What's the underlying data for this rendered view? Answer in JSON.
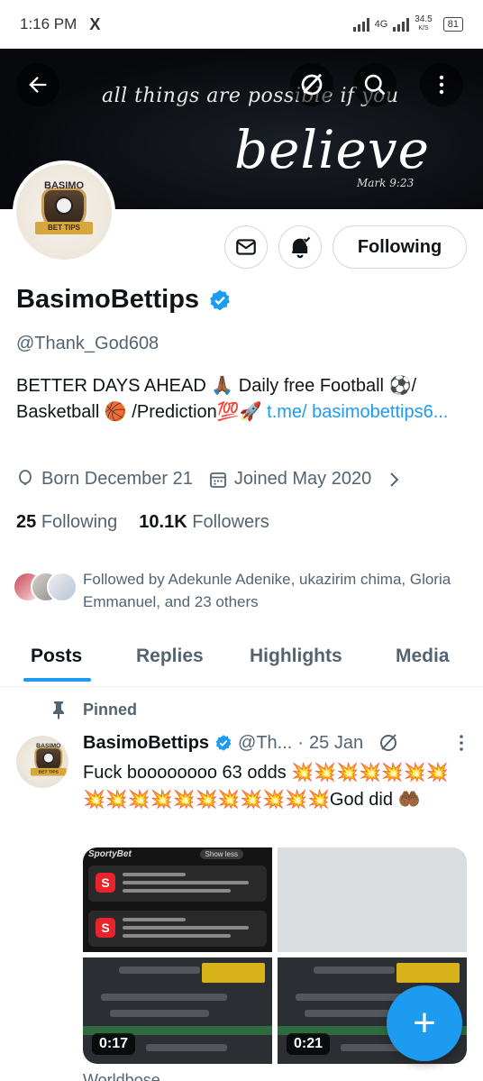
{
  "status_bar": {
    "time": "1:16 PM",
    "app_icon": "X",
    "network": "4G",
    "speed_value": "34.5",
    "speed_unit": "K/S",
    "battery": "81"
  },
  "banner": {
    "line1": "all things are possible if you",
    "line2": "believe",
    "reference": "Mark 9:23"
  },
  "avatar_logo": {
    "name": "BASIMO",
    "ribbon": "BET TIPS"
  },
  "actions": {
    "following_label": "Following"
  },
  "profile": {
    "display_name": "BasimoBettips",
    "handle": "@Thank_God608",
    "bio_text": "BETTER DAYS AHEAD 🙏🏾 Daily free Football ⚽/ Basketball 🏀 /Prediction💯🚀 ",
    "bio_link": "t.me/ basimobettips6...",
    "born": "Born December 21",
    "joined": "Joined May 2020",
    "following_count": "25",
    "following_label": "Following",
    "followers_count": "10.1K",
    "followers_label": "Followers",
    "followed_by": "Followed by Adekunle Adenike, ukazirim chima, Gloria Emmanuel, and 23 others"
  },
  "tabs": [
    {
      "label": "Posts"
    },
    {
      "label": "Replies"
    },
    {
      "label": "Highlights"
    },
    {
      "label": "Media"
    }
  ],
  "post": {
    "pinned_label": "Pinned",
    "name": "BasimoBettips",
    "handle": "@Th...",
    "separator": "·",
    "date": "25 Jan",
    "text": "Fuck boooooooo 63 odds 💥💥💥💥💥💥💥💥💥💥💥💥💥💥💥💥💥💥God did 🤲🏾",
    "media": {
      "sporty_label": "SportyBet",
      "show_less": "Show less",
      "notif_icon": "S",
      "video1_duration": "0:17",
      "video2_duration": "0:21"
    },
    "next_text": "Worldbose"
  },
  "fab_label": "+",
  "colors": {
    "accent": "#1d9bf0",
    "text": "#0f1419",
    "muted": "#536471"
  }
}
